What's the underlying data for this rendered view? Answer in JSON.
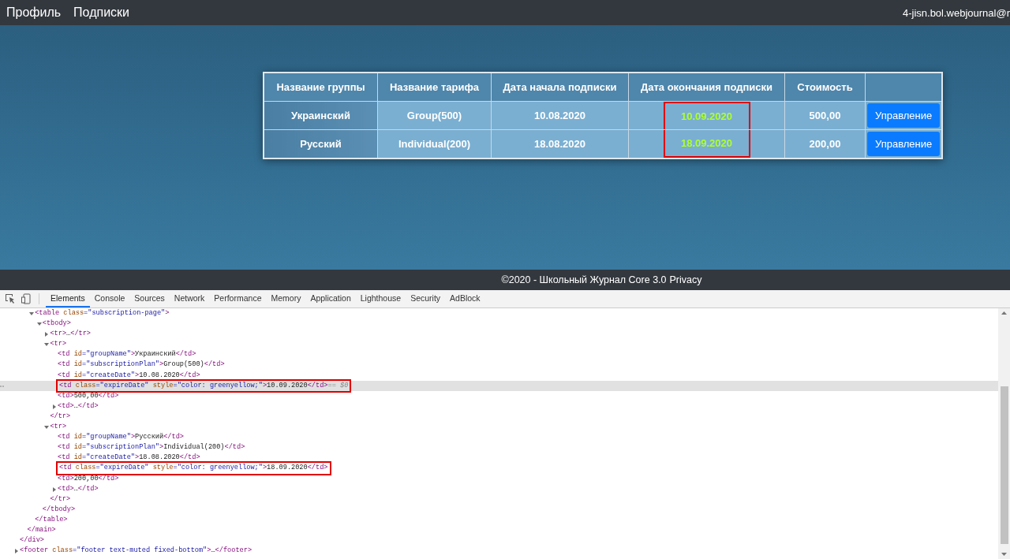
{
  "navbar": {
    "links": [
      "Профиль",
      "Подписки"
    ],
    "user": "4-jisn.bol.webjournal@r"
  },
  "table": {
    "columns": [
      "Название группы",
      "Название тарифа",
      "Дата начала подписки",
      "Дата окончания подписки",
      "Стоимость"
    ],
    "rows": [
      {
        "group": "Украинский",
        "plan": "Group(500)",
        "start_date": "10.08.2020",
        "end_date": "10.09.2020",
        "marked": true,
        "cost": "500,00",
        "button": "Управление"
      },
      {
        "group": "Русский",
        "plan": "Individual(200)",
        "start_date": "18.08.2020",
        "end_date": "18.09.2020",
        "marked": true,
        "cost": "200,00",
        "button": "Управление"
      }
    ]
  },
  "footer": {
    "text": "©2020 - Школьный Журнал Core 3.0",
    "link": "Privacy"
  },
  "devtools": {
    "tabs": [
      {
        "label": "Elements",
        "selected": true
      },
      {
        "label": "Console",
        "selected": false
      },
      {
        "label": "Sources",
        "selected": false
      },
      {
        "label": "Network",
        "selected": false
      },
      {
        "label": "Performance",
        "selected": false
      },
      {
        "label": "Memory",
        "selected": false
      },
      {
        "label": "Application",
        "selected": false
      },
      {
        "label": "Lighthouse",
        "selected": false
      },
      {
        "label": "Security",
        "selected": false
      },
      {
        "label": "AdBlock",
        "selected": false
      }
    ],
    "dom_tree": [
      {
        "close": "</div>",
        "children": [
          {
            "close": "</main>",
            "children": [
              {
                "open": "<table class=\"subscription-page\">",
                "close": "</table>",
                "expanded": true,
                "children": [
                  {
                    "open": "<tbody>",
                    "close": "</tbody>",
                    "expanded": true,
                    "children": [
                      {
                        "open": "<tr>…</tr>",
                        "expanded": false
                      },
                      {
                        "open": "<tr>",
                        "close": "</tr>",
                        "expanded": true,
                        "children": [
                          {
                            "open": "<td id=\"groupName\">Украинский</td>"
                          },
                          {
                            "open": "<td id=\"subscriptionPlan\">Group(500)</td>"
                          },
                          {
                            "open": "<td id=\"createDate\">10.08.2020</td>"
                          },
                          {
                            "open": "<td class=\"expireDate\" style=\"color: greenyellow;\">10.09.2020</td>",
                            "suffix": "== $0",
                            "selected": true,
                            "marked": true
                          },
                          {
                            "open": "<td>500,00</td>"
                          },
                          {
                            "open": "<td>…</td>",
                            "expanded": false
                          }
                        ]
                      },
                      {
                        "open": "<tr>",
                        "close": "</tr>",
                        "expanded": true,
                        "children": [
                          {
                            "open": "<td id=\"groupName\">Русский</td>"
                          },
                          {
                            "open": "<td id=\"subscriptionPlan\">Individual(200)</td>"
                          },
                          {
                            "open": "<td id=\"createDate\">18.08.2020</td>"
                          },
                          {
                            "open": "<td class=\"expireDate\" style=\"color: greenyellow;\">18.09.2020</td>",
                            "selected": false,
                            "marked": true
                          },
                          {
                            "open": "<td>200,00</td>"
                          },
                          {
                            "open": "<td>…</td>",
                            "expanded": false
                          }
                        ]
                      }
                    ]
                  }
                ]
              }
            ]
          }
        ]
      },
      {
        "open": "<footer class=\"footer text-muted fixed-bottom\">…</footer>",
        "expanded": false
      }
    ]
  }
}
